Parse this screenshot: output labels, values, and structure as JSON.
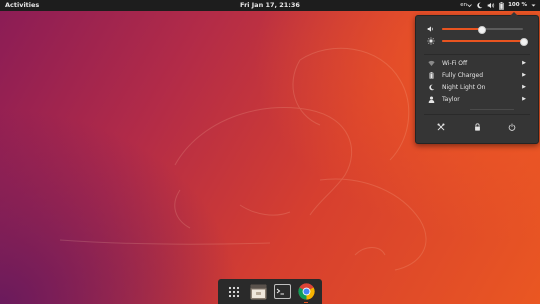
{
  "topbar": {
    "activities_label": "Activities",
    "clock": "Fri Jan 17, 21:36",
    "input_method": "en",
    "battery_percent_label": "100 %",
    "tray_icons": [
      "input-method-icon",
      "night-light-icon",
      "volume-icon",
      "battery-icon",
      "dropdown-arrow-icon"
    ]
  },
  "system_menu": {
    "volume": {
      "icon": "volume-icon",
      "level": 0.48
    },
    "brightness": {
      "icon": "brightness-icon",
      "level": 1.0
    },
    "items": [
      {
        "icon": "wifi-icon",
        "label": "Wi-Fi Off"
      },
      {
        "icon": "battery-icon",
        "label": "Fully Charged"
      },
      {
        "icon": "night-light-icon",
        "label": "Night Light On"
      },
      {
        "icon": "user-icon",
        "label": "Taylor"
      }
    ],
    "actions": [
      {
        "icon": "settings-tools-icon"
      },
      {
        "icon": "lock-icon"
      },
      {
        "icon": "power-icon"
      }
    ]
  },
  "dock": {
    "items": [
      {
        "icon": "show-applications-icon",
        "active": false
      },
      {
        "icon": "files-icon",
        "active": false
      },
      {
        "icon": "terminal-icon",
        "active": false
      },
      {
        "icon": "chrome-icon",
        "active": true
      }
    ]
  },
  "colors": {
    "accent": "#e95420",
    "panel": "#353535",
    "topbar": "#1d1d1d"
  }
}
